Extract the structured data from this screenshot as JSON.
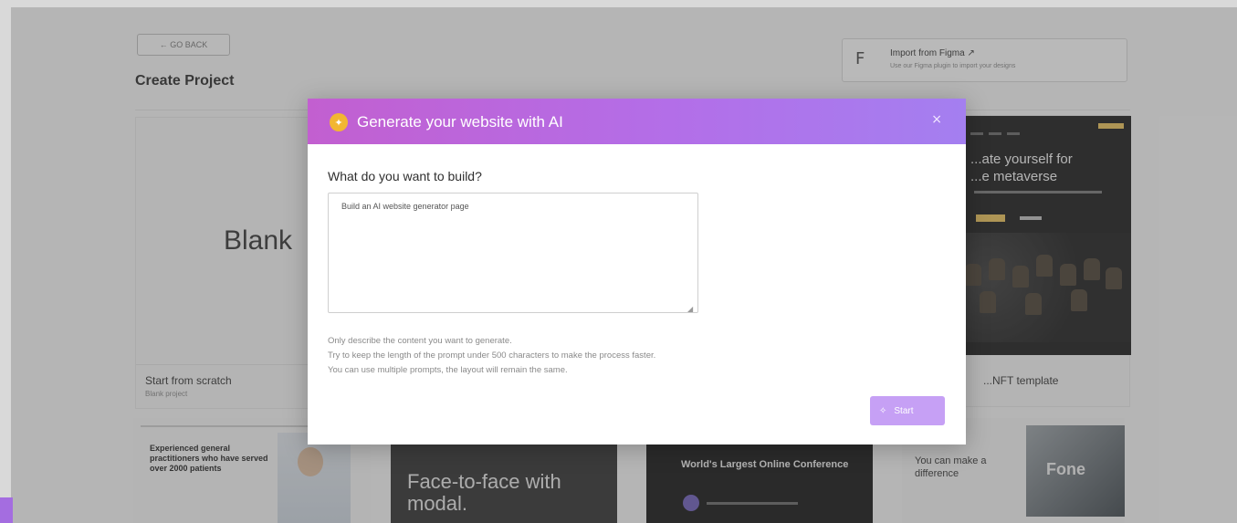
{
  "page": {
    "back_label": "← GO BACK",
    "title": "Create Project",
    "import": {
      "title": "Import from Figma ↗",
      "subtitle": "Use our Figma plugin to import your designs"
    },
    "blank": {
      "word": "Blank",
      "title": "Start from scratch",
      "subtitle": "Blank project"
    },
    "nft": {
      "headline": "...ate yourself for\n...e metaverse",
      "caption": "...NFT template"
    },
    "thumbs": {
      "t1": "Experienced general practitioners who have served over 2000 patients",
      "t2": "Face-to-face with\nmodal.",
      "t3": "World's Largest Online Conference",
      "t4": "You can make a difference"
    }
  },
  "modal": {
    "title": "Generate your website with AI",
    "close": "×",
    "question": "What do you want to build?",
    "prompt_value": "Build an AI website generator page",
    "hints": [
      "Only describe the content you want to generate.",
      "Try to keep the length of the prompt under 500 characters to make the process faster.",
      "You can use multiple prompts, the layout will remain the same."
    ],
    "start_label": "Start",
    "start_icon": "sparkle-icon"
  },
  "colors": {
    "header_start": "#c25fd0",
    "header_end": "#a47ff0",
    "button": "#c6a0f5",
    "ai_icon": "#f2b632"
  }
}
